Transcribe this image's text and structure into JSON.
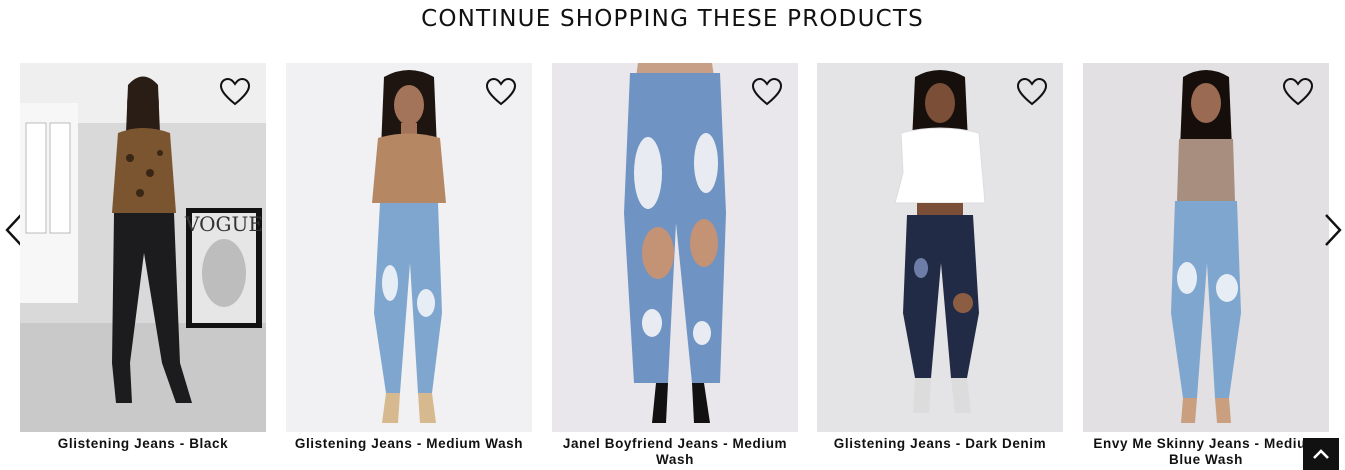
{
  "section": {
    "title": "CONTINUE SHOPPING THESE PRODUCTS"
  },
  "products": [
    {
      "name": "Glistening Jeans - Black"
    },
    {
      "name": "Glistening Jeans - Medium Wash"
    },
    {
      "name": "Janel Boyfriend Jeans - Medium Wash"
    },
    {
      "name": "Glistening Jeans - Dark Denim"
    },
    {
      "name": "Envy Me Skinny Jeans - Medium Blue Wash"
    }
  ],
  "icons": {
    "wishlist": "heart-outline-icon",
    "prev": "chevron-left-icon",
    "next": "chevron-right-icon",
    "back_to_top": "chevron-up-icon"
  },
  "colors": {
    "black_denim": "#1c1c1e",
    "medium_wash": "#7ea6cf",
    "dark_denim": "#222b45",
    "background_light": "#e9e7eb"
  }
}
